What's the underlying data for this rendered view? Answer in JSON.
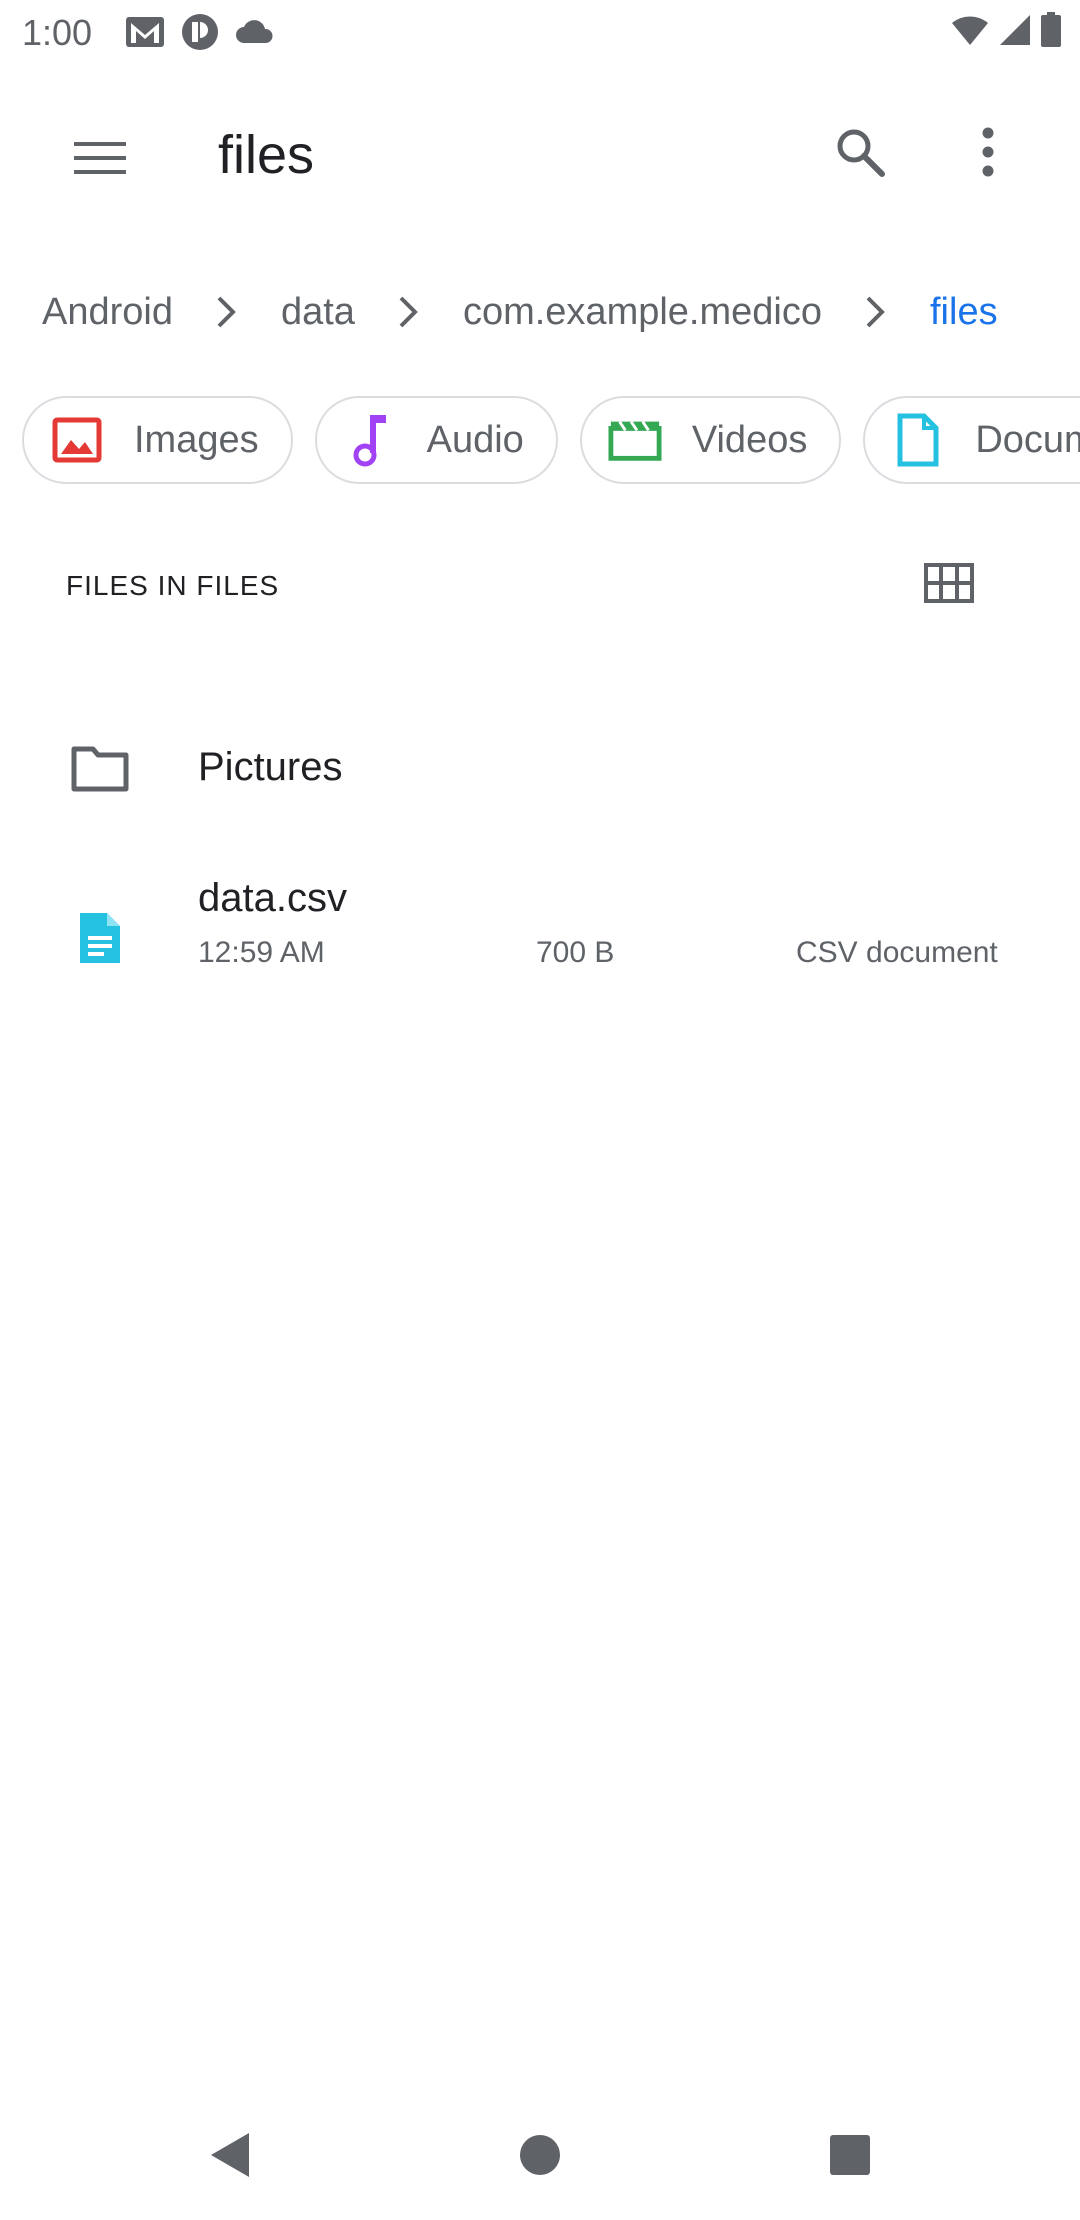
{
  "status_bar": {
    "time": "1:00",
    "left_icons": [
      "gmail-icon",
      "app-notification-icon",
      "cloud-icon"
    ],
    "right_icons": [
      "wifi-icon",
      "signal-icon",
      "battery-icon"
    ]
  },
  "app_bar": {
    "title": "files"
  },
  "breadcrumb": [
    "Android",
    "data",
    "com.example.medico",
    "files"
  ],
  "chips": [
    {
      "label": "Images",
      "icon": "image-icon",
      "color": "#e53935"
    },
    {
      "label": "Audio",
      "icon": "music-note-icon",
      "color": "#a142f4"
    },
    {
      "label": "Videos",
      "icon": "video-icon",
      "color": "#34a853"
    },
    {
      "label": "Documents",
      "icon": "document-icon",
      "color": "#24c1e0"
    }
  ],
  "section": {
    "header": "FILES IN FILES"
  },
  "items": [
    {
      "name": "Pictures",
      "type": "folder"
    },
    {
      "name": "data.csv",
      "date": "12:59 AM",
      "size": "700 B",
      "kind": "CSV document"
    }
  ],
  "colors": {
    "accent": "#1a73e8",
    "icon_gray": "#5f6368",
    "csv_icon": "#24c1e0"
  }
}
